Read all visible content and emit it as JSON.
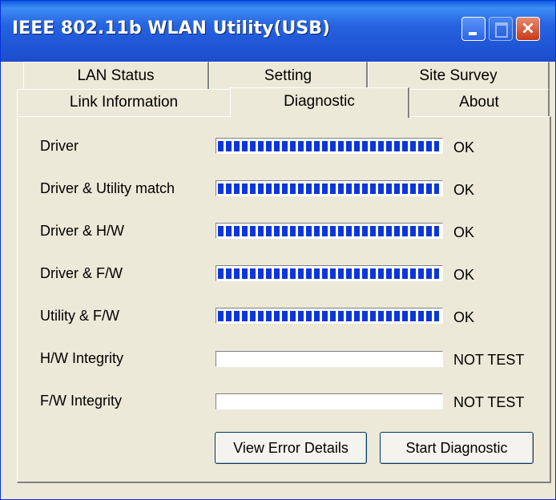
{
  "window": {
    "title": "IEEE 802.11b WLAN Utility(USB)"
  },
  "tabs": {
    "row1": [
      "LAN Status",
      "Setting",
      "Site Survey"
    ],
    "row2": [
      "Link Information",
      "Diagnostic",
      "About"
    ],
    "active": "Diagnostic"
  },
  "diagnostics": [
    {
      "label": "Driver",
      "progress": 1.0,
      "status": "OK"
    },
    {
      "label": "Driver & Utility match",
      "progress": 1.0,
      "status": "OK"
    },
    {
      "label": "Driver & H/W",
      "progress": 1.0,
      "status": "OK"
    },
    {
      "label": "Driver & F/W",
      "progress": 1.0,
      "status": "OK"
    },
    {
      "label": "Utility & F/W",
      "progress": 1.0,
      "status": "OK"
    },
    {
      "label": "H/W Integrity",
      "progress": 0.0,
      "status": "NOT TEST"
    },
    {
      "label": "F/W Integrity",
      "progress": 0.0,
      "status": "NOT TEST"
    }
  ],
  "buttons": {
    "view_error_details": "View Error Details",
    "start_diagnostic": "Start Diagnostic"
  },
  "colors": {
    "progress_fill": "#0b36d8",
    "titlebar": "#1f55d6",
    "dialog_bg": "#ece9d8"
  }
}
